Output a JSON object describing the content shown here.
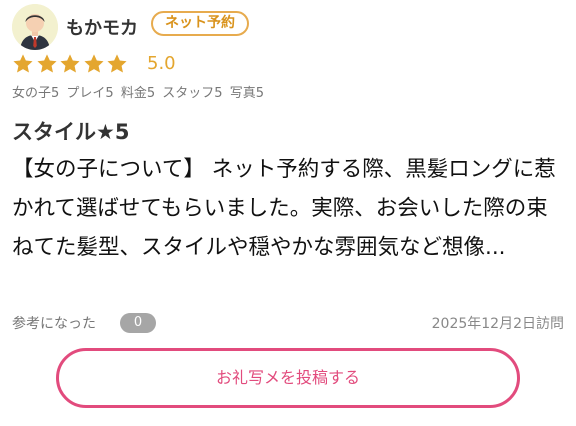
{
  "user": {
    "name": "もかモカ",
    "badge": "ネット予約",
    "avatar_icon": "user-avatar-icon"
  },
  "rating": {
    "stars": 5,
    "max_stars": 5,
    "score": "5.0",
    "star_color": "#e4a62f",
    "star_icon": "star-icon"
  },
  "subratings": [
    {
      "text": "女の子5"
    },
    {
      "text": "プレイ5"
    },
    {
      "text": "料金5"
    },
    {
      "text": "スタッフ5"
    },
    {
      "text": "写真5"
    }
  ],
  "review": {
    "title": "スタイル★5",
    "body": "【女の子について】 ネット予約する際、黒髪ロングに惹かれて選ばせてもらいました。実際、お会いした際の束ねてた髪型、スタイルや穏やかな雰囲気など想像..."
  },
  "helpful": {
    "label": "参考になった",
    "count": "0"
  },
  "visit_date": "2025年12月2日訪問",
  "post_button": {
    "label": "お礼写メを投稿する",
    "color": "#e24b7d"
  }
}
